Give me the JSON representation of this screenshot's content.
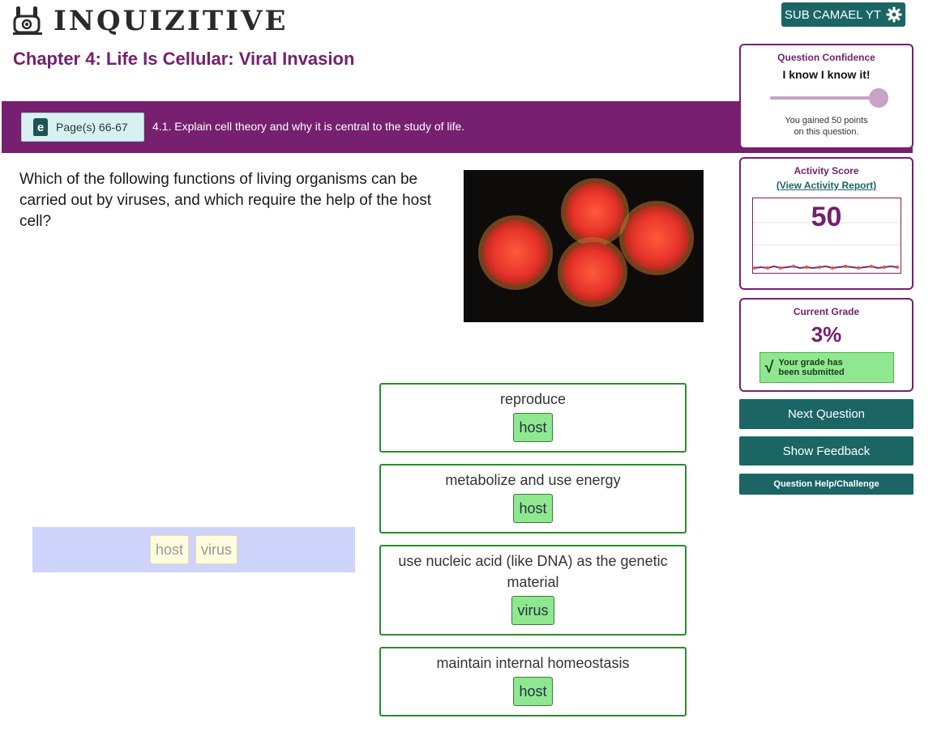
{
  "header": {
    "logo_text": "INQUIZITIVE",
    "user_button_label": "SUB CAMAEL YT",
    "user_button_icon": "gear-icon"
  },
  "chapter": {
    "title": "Chapter 4: Life Is Cellular: Viral Invasion"
  },
  "objective": {
    "page_icon": "ebook-icon",
    "page_icon_letter": "e",
    "page_label": "Page(s) 66-67",
    "text": "4.1. Explain cell theory and why it is central to the study of life."
  },
  "question": {
    "prompt": "Which of the following functions of living organisms can be carried out by viruses, and which require the help of the host cell?"
  },
  "drop_zones": [
    {
      "label": "reproduce",
      "answer": "host"
    },
    {
      "label": "metabolize and use energy",
      "answer": "host"
    },
    {
      "label": "use nucleic acid (like DNA) as the genetic material",
      "answer": "virus"
    },
    {
      "label": "maintain internal homeostasis",
      "answer": "host"
    }
  ],
  "answer_bank": {
    "options": [
      "host",
      "virus"
    ]
  },
  "confidence": {
    "title": "Question Confidence",
    "value": "I know I know it!",
    "level": 1.0,
    "note_line1": "You gained 50 points",
    "note_line2": "on this question."
  },
  "activity": {
    "title": "Activity Score",
    "link": "(View Activity Report)",
    "score": "50"
  },
  "grade": {
    "title": "Current Grade",
    "value": "3%",
    "message_line1": "Your grade has",
    "message_line2": "been submitted"
  },
  "actions": {
    "next": "Next Question",
    "feedback": "Show Feedback",
    "help": "Question Help/Challenge"
  },
  "colors": {
    "brand_purple": "#77206f",
    "teal": "#1b6565",
    "correct_green": "#8fe88f",
    "bank_blue": "#cdd3fb"
  }
}
